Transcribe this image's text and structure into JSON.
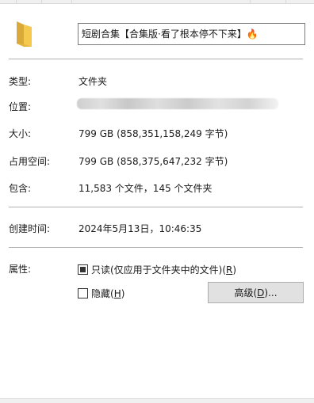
{
  "name_field": {
    "value": "短剧合集【合集版·看了根本停不下来】🔥"
  },
  "properties": [
    {
      "label": "类型:",
      "value": "文件夹"
    },
    {
      "label": "位置:",
      "value": ""
    },
    {
      "label": "大小:",
      "value": "799 GB (858,351,158,249 字节)"
    },
    {
      "label": "占用空间:",
      "value": "799 GB (858,375,647,232 字节)"
    },
    {
      "label": "包含:",
      "value": "11,583 个文件，145 个文件夹"
    }
  ],
  "created": {
    "label": "创建时间:",
    "value": "2024年5月13日，10:46:35"
  },
  "attributes": {
    "label": "属性:",
    "readonly": {
      "label": "只读(仅应用于文件夹中的文件)(",
      "hotkey": "R",
      "suffix": ")",
      "state": "indeterminate"
    },
    "hidden": {
      "label": "隐藏(",
      "hotkey": "H",
      "suffix": ")",
      "state": "unchecked"
    },
    "advanced_button": {
      "label": "高级(",
      "hotkey": "D",
      "suffix": ")..."
    }
  },
  "icons": {
    "folder": "folder-icon",
    "name_emoji": "fire-icon"
  },
  "colors": {
    "folder_body": "#f5c94d",
    "folder_dark": "#d9a93a",
    "divider": "#b0b0b0",
    "button_bg": "#e1e1e1"
  }
}
